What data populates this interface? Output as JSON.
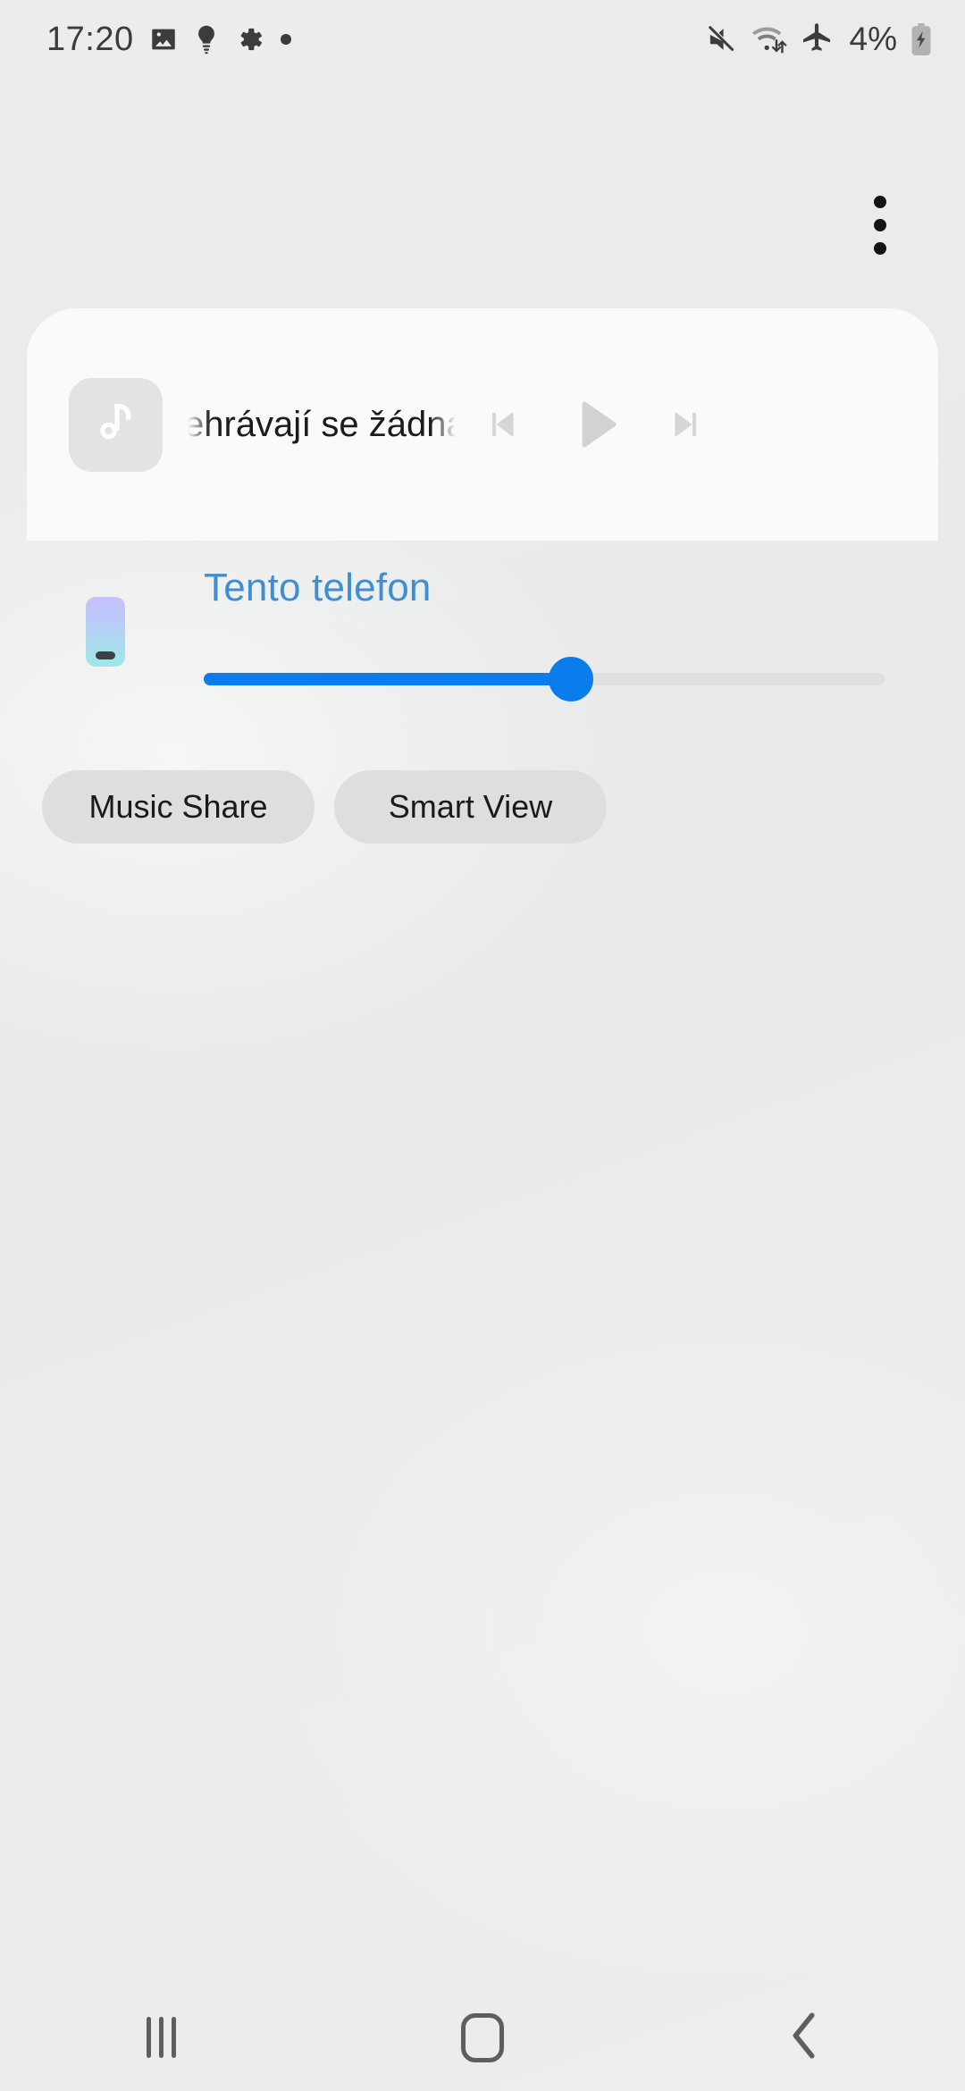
{
  "status_bar": {
    "time": "17:20",
    "left_icons": [
      {
        "name": "image-icon",
        "glyph": "image"
      },
      {
        "name": "lightbulb-icon",
        "glyph": "bulb"
      },
      {
        "name": "settings-gear-icon",
        "glyph": "gear"
      },
      {
        "name": "dot-indicator-icon",
        "glyph": "dot"
      }
    ],
    "right_icons": [
      {
        "name": "mute-icon",
        "glyph": "muted-speaker"
      },
      {
        "name": "wifi-data-icon",
        "glyph": "wifi-arrows"
      },
      {
        "name": "airplane-mode-icon",
        "glyph": "airplane"
      }
    ],
    "battery_percent": "4%",
    "battery_charging": true,
    "text_color": "#3c3c3c"
  },
  "overflow_menu": {
    "name": "more-options",
    "dots": 3
  },
  "media_card": {
    "album_art_icon": "music-note-icon",
    "track_title": "ehrávají se žádná m",
    "full_track_title": "Nepřehrávají se žádná média",
    "controls": [
      {
        "name": "previous-track-button",
        "glyph": "skip-previous"
      },
      {
        "name": "play-button",
        "glyph": "play"
      },
      {
        "name": "next-track-button",
        "glyph": "skip-next"
      }
    ],
    "controls_enabled": false,
    "card_bg": "#fafafa",
    "control_color": "#d6d6d6"
  },
  "output_device": {
    "icon": "phone-device-icon",
    "label": "Tento telefon",
    "label_color": "#3f8ed3",
    "volume": {
      "name": "volume-slider",
      "percent": 54,
      "fill_color": "#0b7ceb",
      "track_color": "#e0e0e0"
    }
  },
  "actions": [
    {
      "name": "music-share-button",
      "label": "Music Share"
    },
    {
      "name": "smart-view-button",
      "label": "Smart View"
    }
  ],
  "nav_bar": {
    "recents_label": "Recents",
    "home_label": "Home",
    "back_label": "Back"
  },
  "theme": {
    "background": "#eaebec",
    "accent": "#0b7ceb",
    "button_bg": "#dedede",
    "nav_icon_color": "#5b5f60"
  }
}
